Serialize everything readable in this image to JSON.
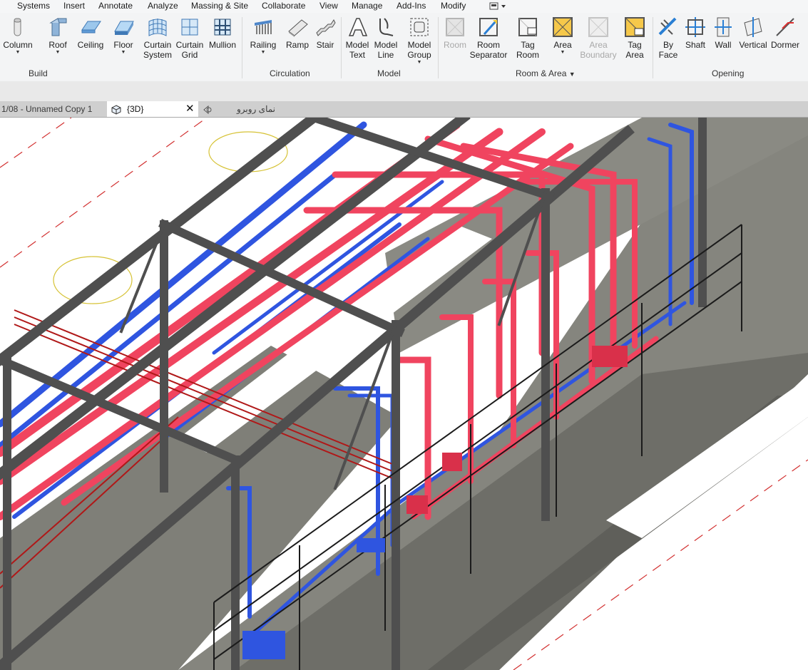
{
  "menu": {
    "items": [
      "Systems",
      "Insert",
      "Annotate",
      "Analyze",
      "Massing & Site",
      "Collaborate",
      "View",
      "Manage",
      "Add-Ins",
      "Modify"
    ]
  },
  "ribbon": {
    "build": {
      "label": "Build",
      "buttons": [
        "Column",
        "Roof",
        "Ceiling",
        "Floor",
        "Curtain\nSystem",
        "Curtain\nGrid",
        "Mullion"
      ]
    },
    "circulation": {
      "label": "Circulation",
      "buttons": [
        "Railing",
        "Ramp",
        "Stair"
      ]
    },
    "model": {
      "label": "Model",
      "buttons": [
        "Model\nText",
        "Model\nLine",
        "Model\nGroup"
      ]
    },
    "room_area": {
      "label": "Room & Area",
      "buttons": [
        "Room",
        "Room\nSeparator",
        "Tag\nRoom",
        "Area",
        "Area\nBoundary",
        "Tag\nArea"
      ]
    },
    "opening": {
      "label": "Opening",
      "buttons": [
        "By\nFace",
        "Shaft",
        "Wall",
        "Vertical",
        "Dormer"
      ]
    }
  },
  "view_tabs": {
    "tab1": "1/08 - Unnamed Copy 1",
    "tab2": "{3D}",
    "tab3": "نمای روبرو"
  },
  "colors": {
    "pipe_red": "#f0445f",
    "pipe_blue": "#2f55e0",
    "steel": "#5c5c5c",
    "concrete": "#8a8a82"
  }
}
